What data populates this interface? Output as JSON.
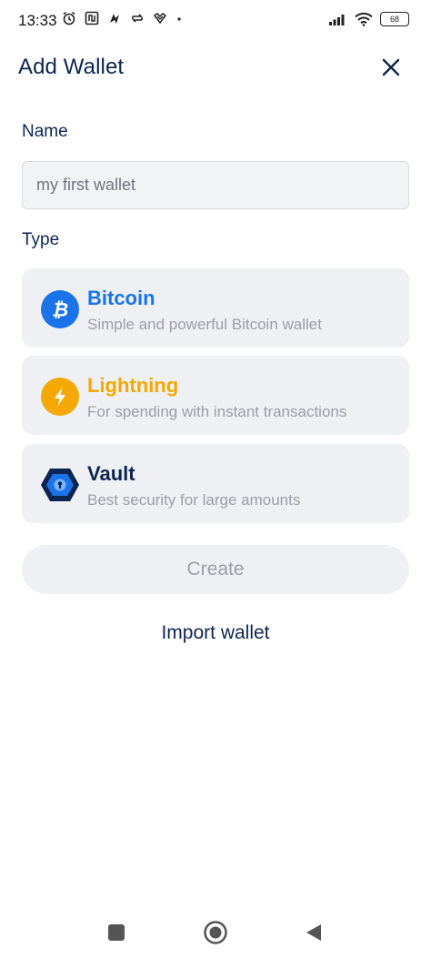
{
  "status_bar": {
    "time": "13:33",
    "battery": "68",
    "left_icons": [
      "alarm-icon",
      "nfc-icon",
      "notification-icon",
      "sync-icon",
      "vpn-icon",
      "dot-icon"
    ],
    "right_icons": [
      "signal-icon",
      "wifi-icon",
      "battery-icon"
    ]
  },
  "header": {
    "title": "Add Wallet",
    "close_icon": "close-icon"
  },
  "form": {
    "name_label": "Name",
    "name_placeholder": "my first wallet",
    "type_label": "Type"
  },
  "wallet_types": [
    {
      "title": "Bitcoin",
      "description": "Simple and powerful Bitcoin wallet",
      "color": "#1a73e8",
      "icon": "bitcoin-icon"
    },
    {
      "title": "Lightning",
      "description": "For spending with instant transactions",
      "color": "#f5a800",
      "icon": "lightning-icon"
    },
    {
      "title": "Vault",
      "description": "Best security for large amounts",
      "color": "#0c2550",
      "icon": "vault-icon"
    }
  ],
  "actions": {
    "create_label": "Create",
    "import_label": "Import wallet"
  },
  "colors": {
    "accent_blue": "#1a73e8",
    "accent_orange": "#f5a800",
    "text_dark": "#0c2550",
    "text_muted": "#9a9ea6",
    "card_bg": "#eff0f4"
  },
  "nav_bar": {
    "buttons": [
      "recent-apps-icon",
      "home-icon",
      "back-icon"
    ]
  }
}
